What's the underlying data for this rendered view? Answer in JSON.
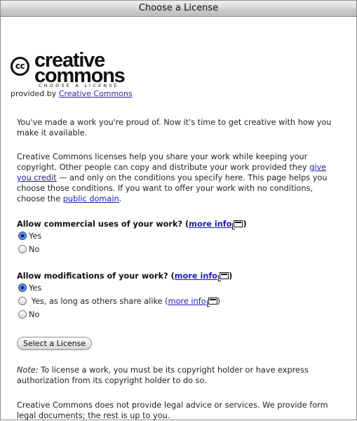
{
  "window": {
    "title": "Choose a License"
  },
  "logo": {
    "word1": "creative",
    "word2": "commons",
    "tagline": "CHOOSE A LICENSE",
    "cc_mark": "cc"
  },
  "provided_by": {
    "prefix": "provided by ",
    "link": "Creative Commons"
  },
  "intro": {
    "p1": "You've made a work you're proud of. Now it's time to get creative with how you make it available.",
    "p2_a": "Creative Commons licenses help you share your work while keeping your copyright. Other people can copy and distribute your work provided they ",
    "p2_link1": "give you credit",
    "p2_b": " — and only on the conditions you specify here. This page helps you choose those conditions. If you want to offer your work with no conditions, choose the ",
    "p2_link2": "public domain",
    "p2_c": "."
  },
  "commercial": {
    "question": "Allow commercial uses of your work?",
    "more_info": "more info",
    "options": [
      {
        "label": "Yes",
        "selected": true
      },
      {
        "label": "No",
        "selected": false
      }
    ]
  },
  "modifications": {
    "question": "Allow modifications of your work?",
    "more_info": "more info",
    "options": [
      {
        "label": "Yes",
        "selected": true
      },
      {
        "label": "Yes, as long as others share alike",
        "selected": false,
        "more_info": "more info"
      },
      {
        "label": "No",
        "selected": false
      }
    ]
  },
  "select_button": "Select a License",
  "note": {
    "label": "Note:",
    "text": " To license a work, you must be its copyright holder or have express authorization from its copyright holder to do so."
  },
  "disclaimer": "Creative Commons does not provide legal advice or services. We provide form legal documents; the rest is up to you."
}
